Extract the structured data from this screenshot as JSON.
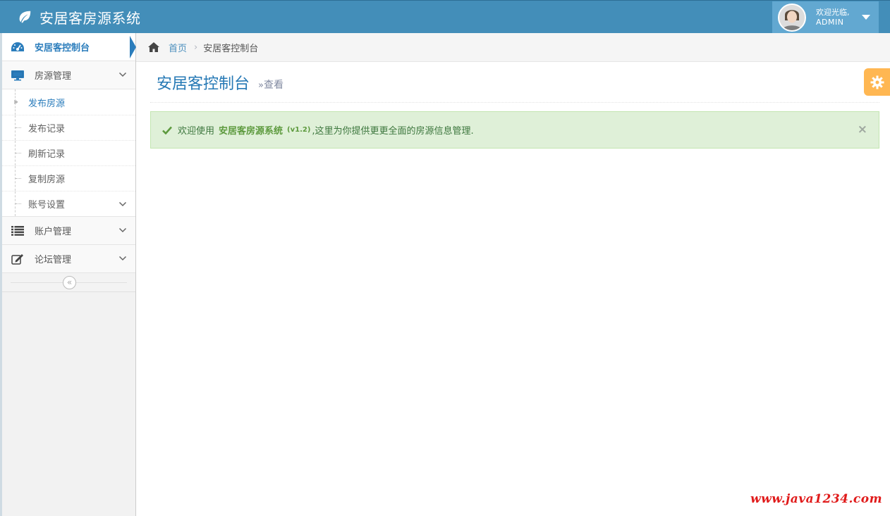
{
  "app": {
    "title": "安居客房源系统",
    "user_welcome": "欢迎光临,",
    "user_name": "ADMIN"
  },
  "sidebar": {
    "items": [
      {
        "label": "安居客控制台",
        "icon": "dashboard-icon",
        "active": true
      },
      {
        "label": "房源管理",
        "icon": "desktop-icon",
        "expanded": true
      },
      {
        "label": "账户管理",
        "icon": "list-icon"
      },
      {
        "label": "论坛管理",
        "icon": "edit-icon"
      }
    ],
    "submenu": [
      {
        "label": "发布房源",
        "active": true
      },
      {
        "label": "发布记录"
      },
      {
        "label": "刷新记录"
      },
      {
        "label": "复制房源"
      },
      {
        "label": "账号设置",
        "has_children": true
      }
    ],
    "collapse_glyph": "«"
  },
  "breadcrumb": {
    "home": "首页",
    "separator": "›",
    "current": "安居客控制台"
  },
  "page": {
    "title": "安居客控制台",
    "subtitle_prefix": "»",
    "subtitle": "查看"
  },
  "alert": {
    "prefix": "欢迎使用",
    "strong": "安居客房源系统",
    "version": "(v1.2)",
    "text": ",这里为你提供更更全面的房源信息管理.",
    "close": "×"
  },
  "watermark": "www.java1234.com",
  "colors": {
    "navbar": "#438eb9",
    "user_area": "#62a8d1",
    "accent": "#2b7dbc",
    "alert_bg": "#dff0d8",
    "settings": "#ffb752",
    "watermark": "#e01b1b"
  }
}
